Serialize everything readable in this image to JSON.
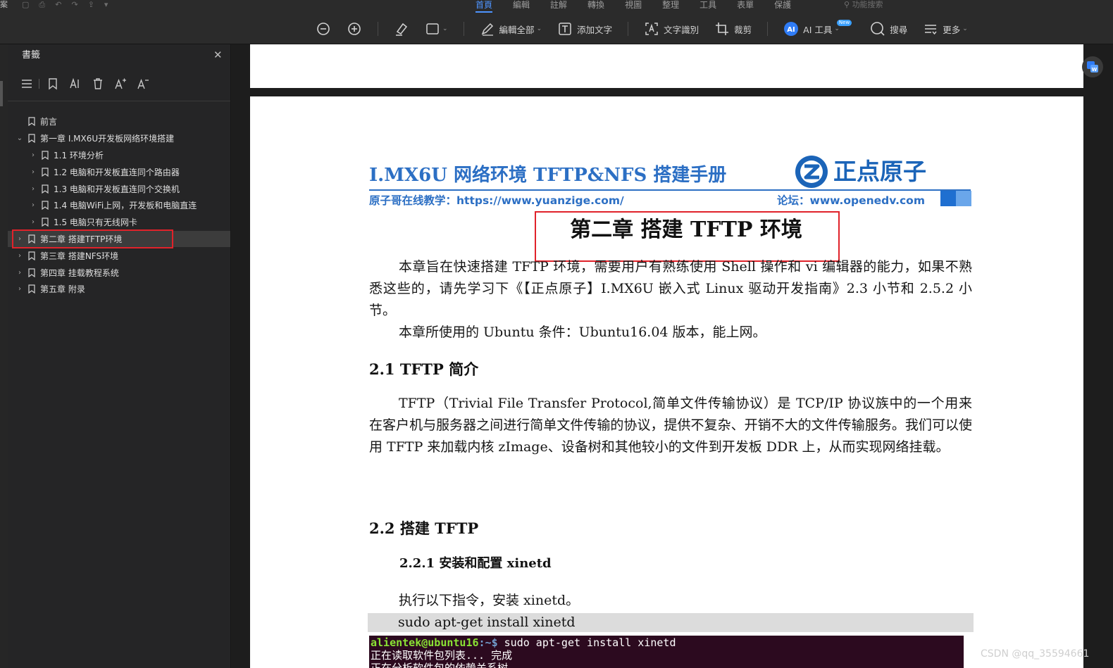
{
  "quickbar": {
    "file_label": "案"
  },
  "menu": {
    "tabs": [
      "首頁",
      "編輯",
      "註解",
      "轉換",
      "視圖",
      "整理",
      "工具",
      "表單",
      "保護"
    ],
    "feature_search": "功能搜索"
  },
  "toolbar": {
    "edit_all": "編輯全部",
    "add_text": "添加文字",
    "ocr": "文字識別",
    "crop": "裁剪",
    "ai_tools": "AI 工具",
    "ai_new_badge": "New",
    "search": "搜尋",
    "more": "更多"
  },
  "sidebar": {
    "title": "書籤",
    "items": [
      {
        "label": "前言",
        "level": 0,
        "expand": ""
      },
      {
        "label": "第一章 I.MX6U开发板网络环境搭建",
        "level": 0,
        "expand": "⌄"
      },
      {
        "label": "1.1 环境分析",
        "level": 1,
        "expand": "›"
      },
      {
        "label": "1.2 电脑和开发板直连同个路由器",
        "level": 1,
        "expand": "›"
      },
      {
        "label": "1.3 电脑和开发板直连同个交换机",
        "level": 1,
        "expand": "›"
      },
      {
        "label": "1.4 电脑WiFi上网，开发板和电脑直连",
        "level": 1,
        "expand": "›"
      },
      {
        "label": "1.5 电脑只有无线网卡",
        "level": 1,
        "expand": "›"
      },
      {
        "label": "第二章 搭建TFTP环境",
        "level": 0,
        "expand": "›"
      },
      {
        "label": "第三章 搭建NFS环境",
        "level": 0,
        "expand": "›"
      },
      {
        "label": "第四章 挂载教程系统",
        "level": 0,
        "expand": "›"
      },
      {
        "label": "第五章 附录",
        "level": 0,
        "expand": "›"
      }
    ]
  },
  "document": {
    "header_title": "I.MX6U 网络环境 TFTP&NFS 搭建手册",
    "logo_text": "正点原子",
    "header_left": "原子哥在线教学：https://www.yuanzige.com/",
    "header_right": "论坛：www.openedv.com",
    "chapter_title": "第二章 搭建 TFTP 环境",
    "intro_p1": "本章旨在快速搭建 TFTP 环境，需要用户有熟练使用 Shell 操作和 vi 编辑器的能力，如果不熟悉这些的，请先学习下《【正点原子】I.MX6U 嵌入式 Linux 驱动开发指南》2.3 小节和 2.5.2 小节。",
    "intro_p2": "本章所使用的 Ubuntu 条件：Ubuntu16.04 版本，能上网。",
    "s21_title": "2.1 TFTP 简介",
    "s21_body": "TFTP（Trivial File Transfer Protocol,简单文件传输协议）是 TCP/IP 协议族中的一个用来在客户机与服务器之间进行简单文件传输的协议，提供不复杂、开销不大的文件传输服务。我们可以使用 TFTP 来加载内核 zImage、设备树和其他较小的文件到开发板 DDR 上，从而实现网络挂载。",
    "s22_title": "2.2 搭建 TFTP",
    "s221_title": "2.2.1 安装和配置 xinetd",
    "s221_body": "执行以下指令，安装 xinetd。",
    "command": "sudo apt-get install xinetd",
    "terminal": {
      "user_host": "alientek@ubuntu16",
      "path": ":~$",
      "command": " sudo apt-get install xinetd",
      "line2": "正在读取软件包列表... 完成",
      "line3": "正在分析软件包的依赖关系树"
    }
  },
  "watermark": "CSDN @qq_35594661",
  "colors": {
    "accent": "#4e94ff",
    "doc_blue": "#2c6fc4",
    "highlight_red": "#e0222a",
    "terminal_bg": "#2c0a1f"
  }
}
